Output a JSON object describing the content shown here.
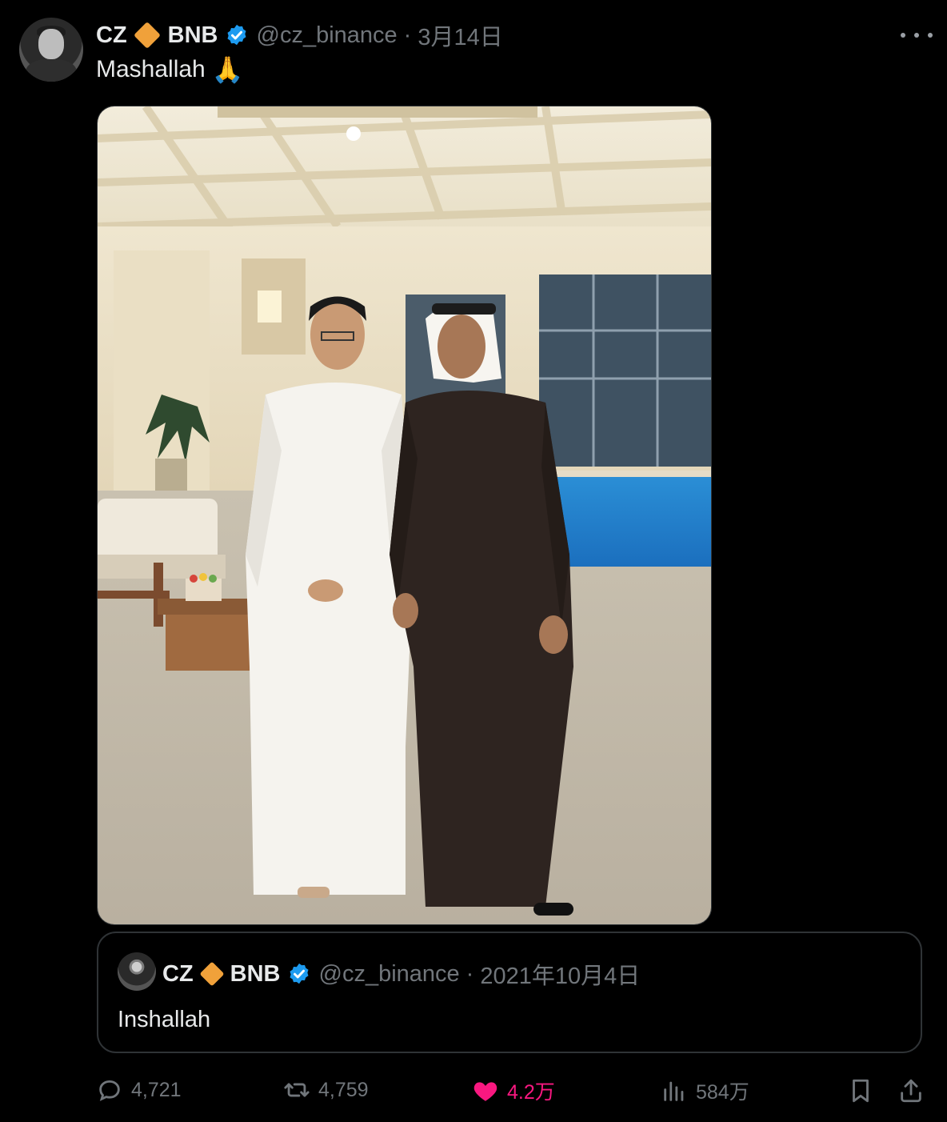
{
  "tweet": {
    "author_name": "CZ",
    "author_suffix": "BNB",
    "handle": "@cz_binance",
    "separator": "·",
    "date": "3月14日",
    "text": "Mashallah",
    "emoji": "🙏"
  },
  "quoted_tweet": {
    "author_name": "CZ",
    "author_suffix": "BNB",
    "handle": "@cz_binance",
    "separator": "·",
    "date": "2021年10月4日",
    "text": "Inshallah"
  },
  "actions": {
    "replies": "4,721",
    "retweets": "4,759",
    "likes": "4.2万",
    "views": "584万"
  },
  "colors": {
    "background": "#000000",
    "text": "#e7e9ea",
    "muted": "#71767b",
    "like": "#f91880",
    "verified": "#1d9bf0",
    "bnb_diamond": "#f0a13a"
  },
  "icons": [
    "more-icon",
    "verified-badge-icon",
    "bnb-diamond-icon",
    "reply-icon",
    "retweet-icon",
    "like-icon",
    "views-icon",
    "bookmark-icon",
    "share-icon"
  ]
}
